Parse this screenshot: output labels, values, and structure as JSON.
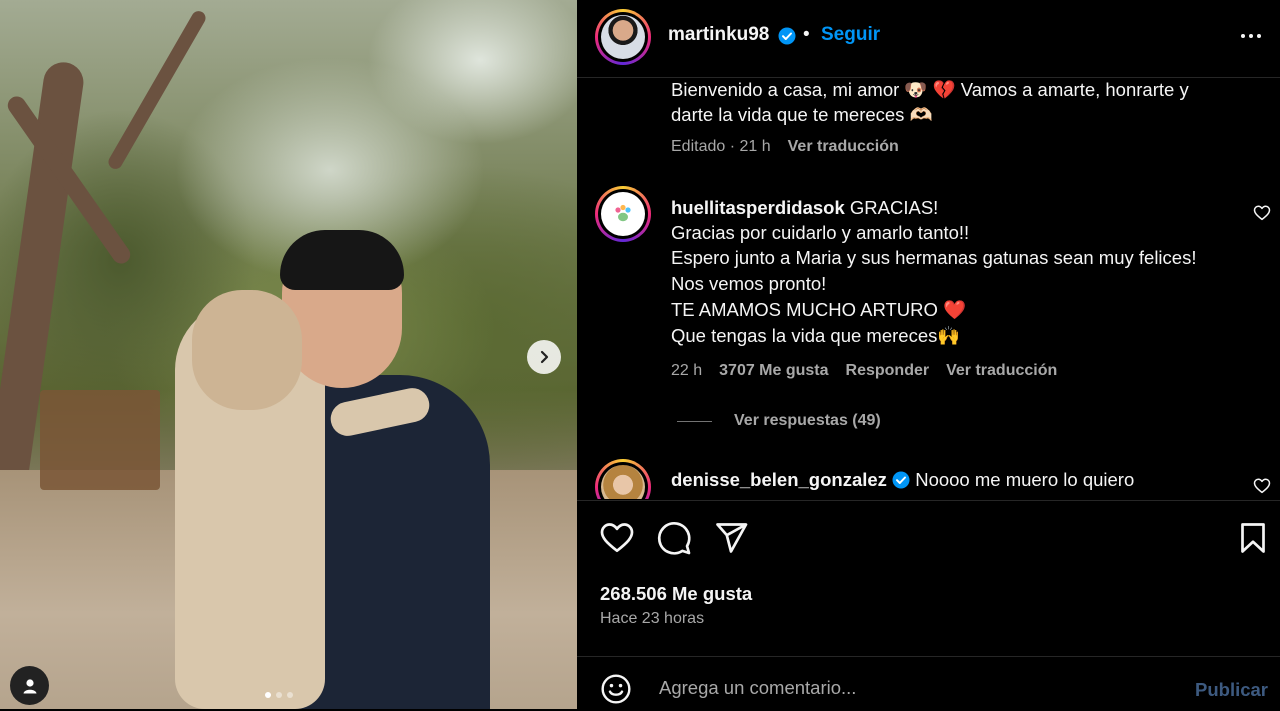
{
  "post": {
    "username": "martinku98",
    "follow_label": "Seguir",
    "separator": "•",
    "caption_line1": "Bienvenido a casa, mi amor 🐶 💔 Vamos a amarte, honrarte y",
    "caption_line2": "darte la vida que te mereces 🫶🏻",
    "caption_edited": "Editado · 21 h",
    "caption_translate": "Ver traducción"
  },
  "comments": [
    {
      "username": "huellitasperdidasok",
      "lines": [
        "GRACIAS!",
        "Gracias por cuidarlo y amarlo tanto!!",
        "Espero junto a Maria y sus hermanas gatunas sean muy felices!",
        "Nos vemos pronto!",
        "TE AMAMOS MUCHO ARTURO ❤️",
        "Que tengas la vida que mereces🙌"
      ],
      "time": "22 h",
      "likes": "3707 Me gusta",
      "reply": "Responder",
      "translate": "Ver traducción",
      "view_replies": "Ver respuestas (49)"
    },
    {
      "username": "denisse_belen_gonzalez",
      "text": "Noooo me muero lo quiero"
    }
  ],
  "stats": {
    "likes": "268.506 Me gusta",
    "posted": "Hace 23 horas"
  },
  "composer": {
    "placeholder": "Agrega un comentario...",
    "publish_label": "Publicar"
  },
  "icons": {
    "like": "heart-icon",
    "comment": "comment-icon",
    "share": "send-icon",
    "save": "bookmark-icon",
    "more": "more-dots-icon",
    "emoji": "emoji-icon",
    "next": "chevron-right-icon",
    "user_tag": "user-tag-icon"
  },
  "colors": {
    "accent": "#0095f6",
    "publish_disabled": "#3d5a80",
    "secondary_text": "#a8a8a8"
  },
  "carousel": {
    "slides": 3,
    "active_slide": 1
  }
}
